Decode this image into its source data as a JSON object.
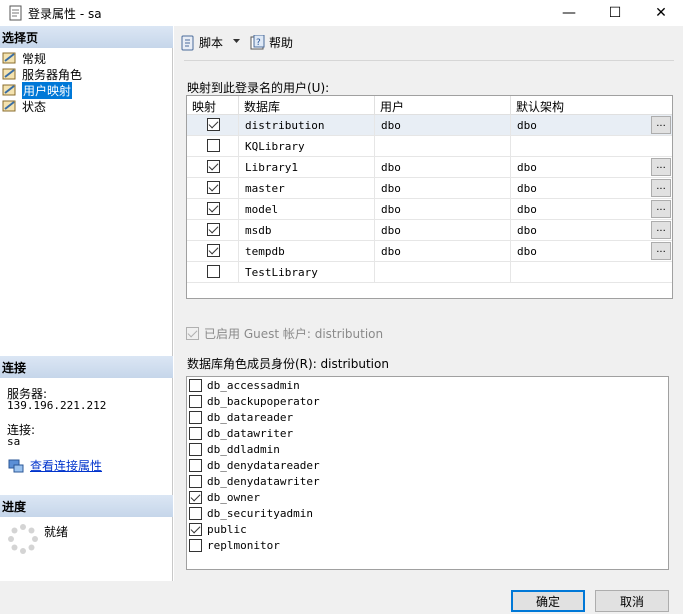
{
  "window": {
    "title": "登录属性 - sa",
    "minimize": "—",
    "maximize": "☐",
    "close": "✕"
  },
  "left": {
    "select_page_header": "选择页",
    "nav_items": [
      "常规",
      "服务器角色",
      "用户映射",
      "状态"
    ],
    "selected_nav": "用户映射",
    "connection_header": "连接",
    "server_label": "服务器:",
    "server_value": "139.196.221.212",
    "connection_label": "连接:",
    "connection_value": "sa",
    "view_connection_link": "查看连接属性",
    "progress_header": "进度",
    "progress_status": "就绪"
  },
  "toolbar": {
    "script_label": "脚本",
    "help_label": "帮助"
  },
  "users_grid": {
    "label": "映射到此登录名的用户(U):",
    "columns": [
      "映射",
      "数据库",
      "用户",
      "默认架构"
    ],
    "rows": [
      {
        "map": true,
        "db": "distribution",
        "user": "dbo",
        "schema": "dbo",
        "ellipsis": "..."
      },
      {
        "map": false,
        "db": "KQLibrary",
        "user": "",
        "schema": "",
        "ellipsis": ""
      },
      {
        "map": true,
        "db": "Library1",
        "user": "dbo",
        "schema": "dbo",
        "ellipsis": "..."
      },
      {
        "map": true,
        "db": "master",
        "user": "dbo",
        "schema": "dbo",
        "ellipsis": "..."
      },
      {
        "map": true,
        "db": "model",
        "user": "dbo",
        "schema": "dbo",
        "ellipsis": "..."
      },
      {
        "map": true,
        "db": "msdb",
        "user": "dbo",
        "schema": "dbo",
        "ellipsis": "..."
      },
      {
        "map": true,
        "db": "tempdb",
        "user": "dbo",
        "schema": "dbo",
        "ellipsis": "..."
      },
      {
        "map": false,
        "db": "TestLibrary",
        "user": "",
        "schema": "",
        "ellipsis": ""
      }
    ]
  },
  "guest": {
    "label": "已启用 Guest 帐户: distribution",
    "checked": true
  },
  "roles": {
    "label": "数据库角色成员身份(R): distribution",
    "items": [
      {
        "name": "db_accessadmin",
        "checked": false
      },
      {
        "name": "db_backupoperator",
        "checked": false
      },
      {
        "name": "db_datareader",
        "checked": false
      },
      {
        "name": "db_datawriter",
        "checked": false
      },
      {
        "name": "db_ddladmin",
        "checked": false
      },
      {
        "name": "db_denydatareader",
        "checked": false
      },
      {
        "name": "db_denydatawriter",
        "checked": false
      },
      {
        "name": "db_owner",
        "checked": true
      },
      {
        "name": "db_securityadmin",
        "checked": false
      },
      {
        "name": "public",
        "checked": true
      },
      {
        "name": "replmonitor",
        "checked": false
      }
    ]
  },
  "buttons": {
    "ok": "确定",
    "cancel": "取消"
  }
}
